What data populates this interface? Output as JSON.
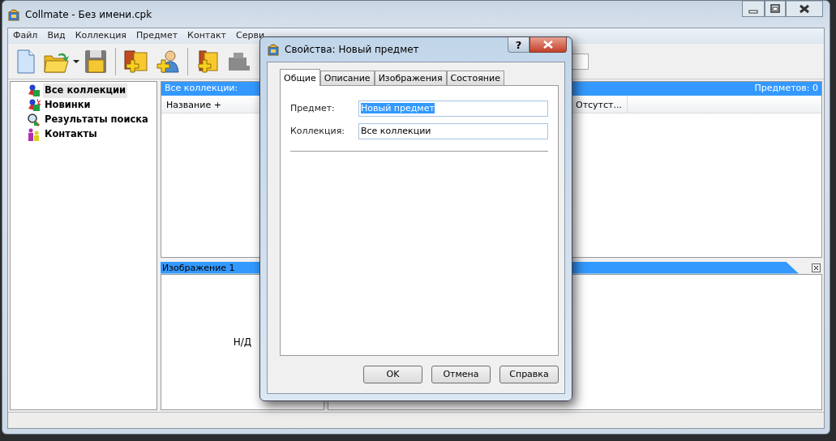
{
  "window": {
    "title": "Collmate - Без имени.cpk"
  },
  "menu": [
    "Файл",
    "Вид",
    "Коллекция",
    "Предмет",
    "Контакт",
    "Серви"
  ],
  "tree": [
    {
      "label": "Все коллекции",
      "selected": true,
      "kind": "all"
    },
    {
      "label": "Новинки",
      "selected": false,
      "kind": "new"
    },
    {
      "label": "Результаты поиска",
      "selected": false,
      "kind": "search"
    },
    {
      "label": "Контакты",
      "selected": false,
      "kind": "contacts"
    }
  ],
  "list": {
    "title": "Все коллекции:",
    "count": "Предметов: 0",
    "columns": [
      "Название +",
      "Отсутст..."
    ]
  },
  "image_pane": {
    "title": "Изображение 1",
    "empty_text": "Н/Д"
  },
  "dialog": {
    "title": "Свойства: Новый предмет",
    "help": "?",
    "tabs": [
      {
        "label": "Общие",
        "selected": true
      },
      {
        "label": "Описание",
        "selected": false
      },
      {
        "label": "Изображения",
        "selected": false
      },
      {
        "label": "Состояние",
        "selected": false
      }
    ],
    "fields": [
      {
        "label": "Предмет:",
        "value": "Новый предмет",
        "selected": true
      },
      {
        "label": "Коллекция:",
        "value": "Все коллекции",
        "selected": false
      }
    ],
    "buttons": [
      "OK",
      "Отмена",
      "Справка"
    ]
  }
}
